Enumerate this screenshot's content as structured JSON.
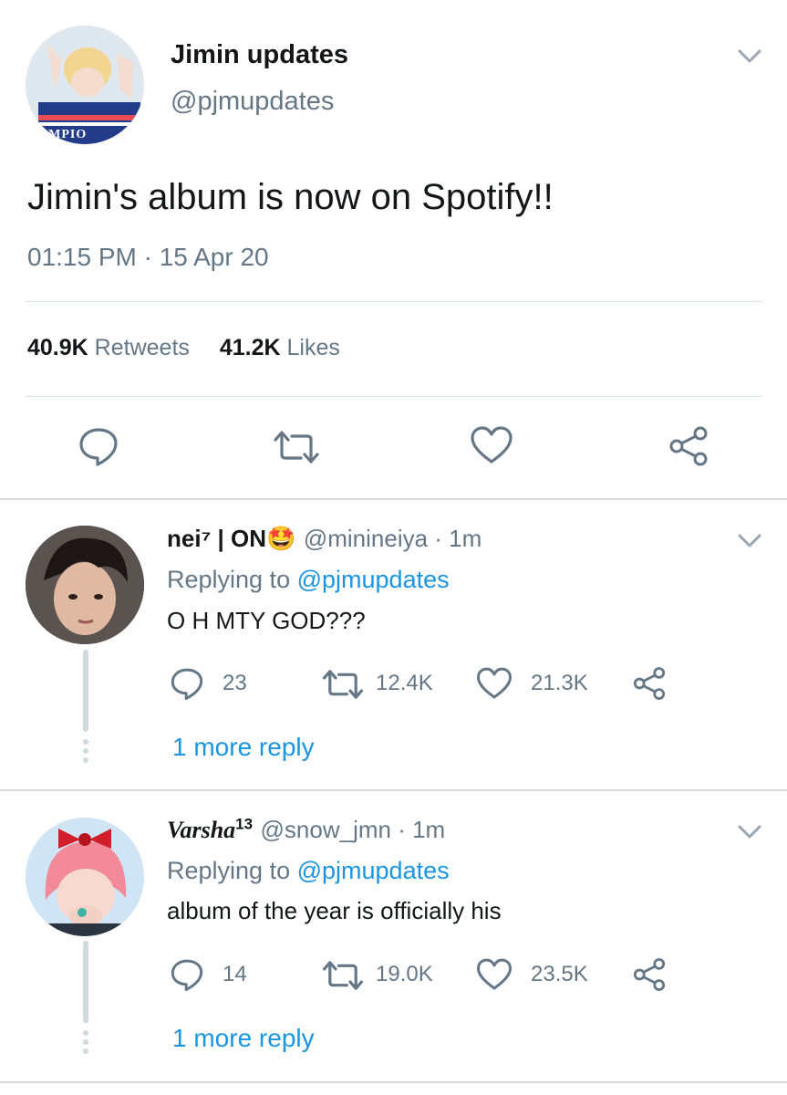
{
  "tweet": {
    "display_name": "Jimin updates",
    "handle": "@pjmupdates",
    "avatar_text": "AMPIO",
    "text": "Jimin's album is now on Spotify!!",
    "timestamp": "01:15 PM · 15 Apr 20",
    "retweets_count": "40.9K",
    "retweets_label": "Retweets",
    "likes_count": "41.2K",
    "likes_label": "Likes",
    "icons": [
      "reply-icon",
      "retweet-icon",
      "like-icon",
      "share-icon",
      "chevron-down-icon"
    ]
  },
  "replies": [
    {
      "display_name": "nei⁷ | ON",
      "emoji": "🤩",
      "handle_time": "@minineiya · 1m",
      "replying_prefix": "Replying to",
      "replying_handle": "@pjmupdates",
      "text": "O H MTY GOD???",
      "reply_count": "23",
      "retweet_count": "12.4K",
      "like_count": "21.3K",
      "more": "1 more reply"
    },
    {
      "display_name": "Varsha",
      "display_sup": "13",
      "handle_time": "@snow_jmn · 1m",
      "replying_prefix": "Replying to",
      "replying_handle": "@pjmupdates",
      "text": "album of the year is officially his",
      "reply_count": "14",
      "retweet_count": "19.0K",
      "like_count": "23.5K",
      "more": "1 more reply"
    }
  ],
  "colors": {
    "text": "#14171a",
    "muted": "#657786",
    "link": "#1b95e0",
    "divider": "#d9dfe3"
  }
}
